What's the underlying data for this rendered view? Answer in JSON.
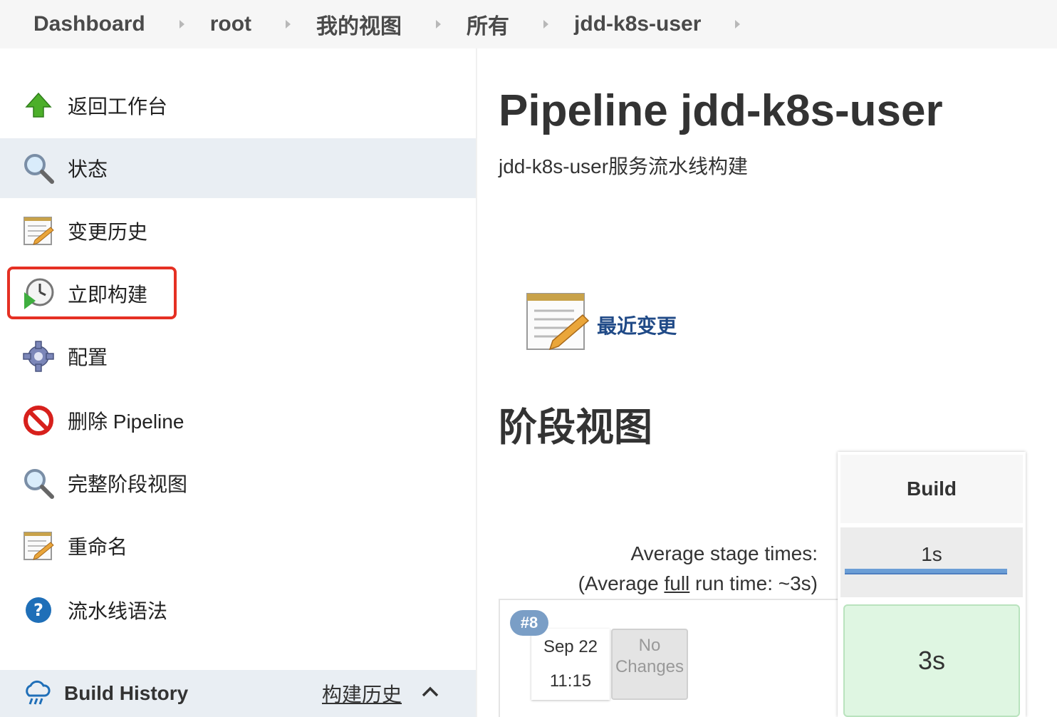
{
  "breadcrumb": [
    "Dashboard",
    "root",
    "我的视图",
    "所有",
    "jdd-k8s-user"
  ],
  "sidebar": {
    "items": [
      {
        "label": "返回工作台",
        "icon": "up-arrow-icon"
      },
      {
        "label": "状态",
        "icon": "magnifier-icon"
      },
      {
        "label": "变更历史",
        "icon": "notepad-icon"
      },
      {
        "label": "立即构建",
        "icon": "clock-build-icon"
      },
      {
        "label": "配置",
        "icon": "gear-icon"
      },
      {
        "label": "删除 Pipeline",
        "icon": "no-entry-icon"
      },
      {
        "label": "完整阶段视图",
        "icon": "magnifier-icon"
      },
      {
        "label": "重命名",
        "icon": "notepad-icon"
      },
      {
        "label": "流水线语法",
        "icon": "help-icon"
      }
    ],
    "build_history": {
      "title": "Build History",
      "link": "构建历史"
    }
  },
  "main": {
    "title": "Pipeline jdd-k8s-user",
    "description": "jdd-k8s-user服务流水线构建",
    "recent_changes": "最近变更",
    "stage_view_title": "阶段视图",
    "avg_stage_times": "Average stage times:",
    "avg_full_prefix": "(Average ",
    "avg_full_word": "full",
    "avg_full_suffix": " run time: ~3s)",
    "stage": {
      "name": "Build",
      "avg": "1s",
      "avg_fraction": 1.0
    },
    "run": {
      "number": "#8",
      "date": "Sep 22",
      "time": "11:15",
      "changes_line1": "No",
      "changes_line2": "Changes",
      "duration": "3s"
    }
  },
  "colors": {
    "highlight": "#e53023",
    "link": "#204a87",
    "success_cell": "#dff6e2",
    "active_row": "#e9eef3"
  }
}
